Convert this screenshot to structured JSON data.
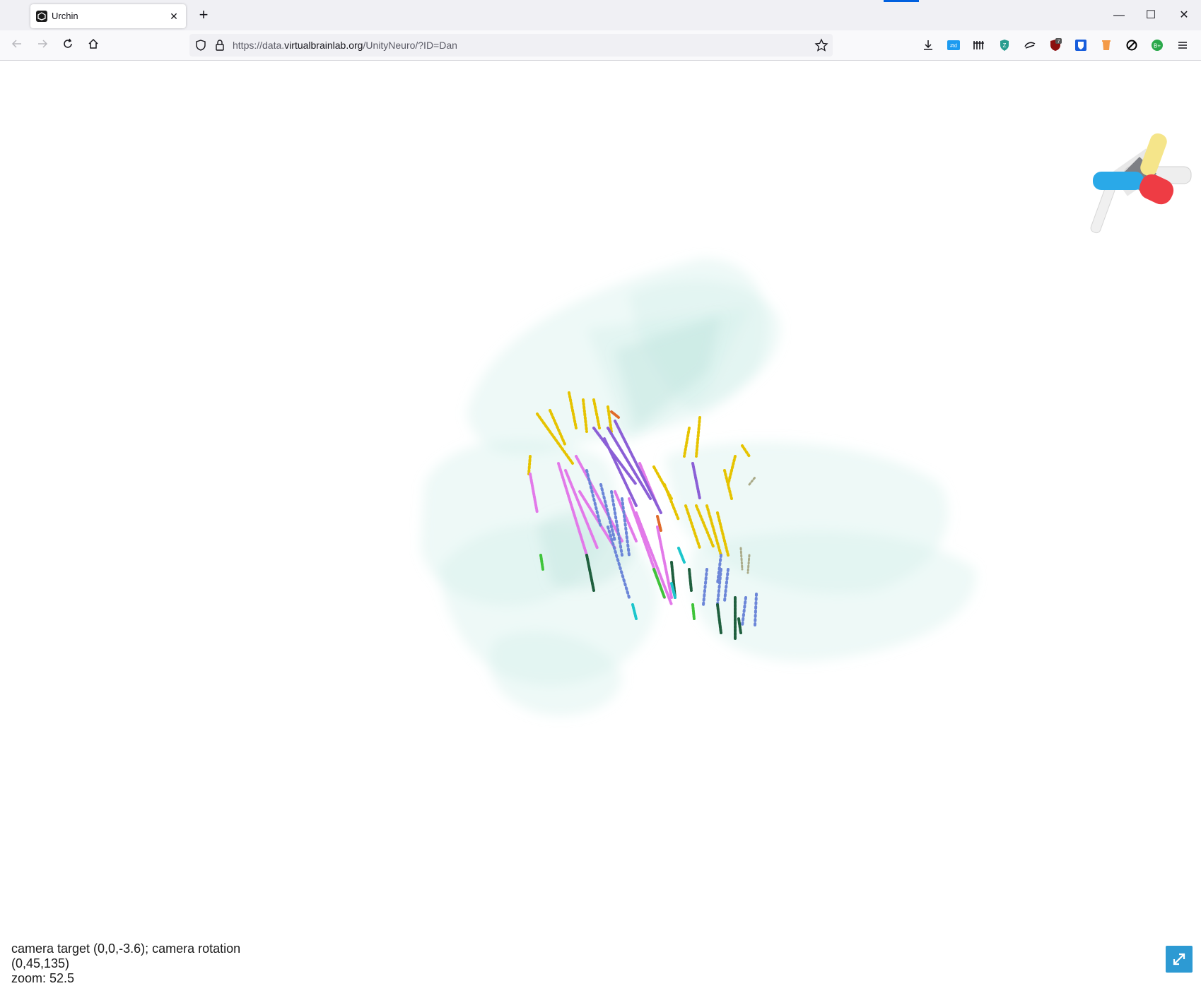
{
  "browser": {
    "tab_title": "Urchin",
    "tab_close": "✕",
    "new_tab": "+",
    "url": {
      "prefix": "https://data.",
      "domain": "virtualbrainlab.org",
      "path": "/UnityNeuro/?ID=Dan"
    },
    "window": {
      "minimize": "—",
      "maximize": "☐",
      "close": "✕"
    },
    "toolbar_icons": [
      "downloads-icon",
      "tweetdeck-icon",
      "columns-icon",
      "privacy-badger-icon",
      "extension-icon",
      "ublock-origin-icon",
      "bitwarden-icon",
      "trash-icon",
      "blocked-icon",
      "b-plus-icon",
      "menu-icon"
    ],
    "ublock_badge": "7",
    "b_plus_label": "B+"
  },
  "app": {
    "status_line": "camera target (0,0,-3.6); camera rotation (0,45,135)",
    "zoom_line": "zoom: 52.5",
    "colors": {
      "brain_mesh": "#c9ebe6",
      "axis_x": "#2aa9e8",
      "axis_y": "#f5e58a",
      "axis_z": "#ee3c44",
      "fullscreen": "#2d9ad3"
    }
  }
}
